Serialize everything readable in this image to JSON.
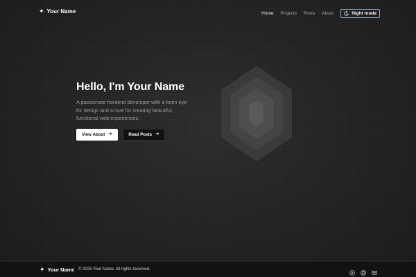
{
  "header": {
    "brand_icon": "sparkle-icon",
    "brand_name": "Your Name",
    "nav": {
      "home": "Home",
      "projects": "Projects",
      "posts": "Posts",
      "about": "About"
    },
    "theme_toggle_label": "Night mode",
    "theme_toggle_icon": "moon-icon"
  },
  "hero": {
    "title": "Hello, I'm Your Name",
    "bio_line_1": "A passionate frontend developer with a keen eye",
    "bio_line_2": "for design and a love for creating beautiful,",
    "bio_line_3": "functional web experiences.",
    "primary_button": "View About",
    "secondary_button": "Read Posts",
    "button_icon": "arrow-right-icon",
    "art_icon": "hexagon-layers-icon"
  },
  "footer": {
    "brand_name": "Your Name",
    "copyright": "© 2025 Your Name. All rights reserved.",
    "social_icons": [
      "x-icon",
      "github-icon",
      "mail-icon"
    ]
  },
  "colors": {
    "background": "#222222",
    "footer_background": "#121212",
    "text_primary": "#ffffff",
    "text_muted": "#9d9d9d",
    "toggle_border": "#8fa6c4"
  }
}
